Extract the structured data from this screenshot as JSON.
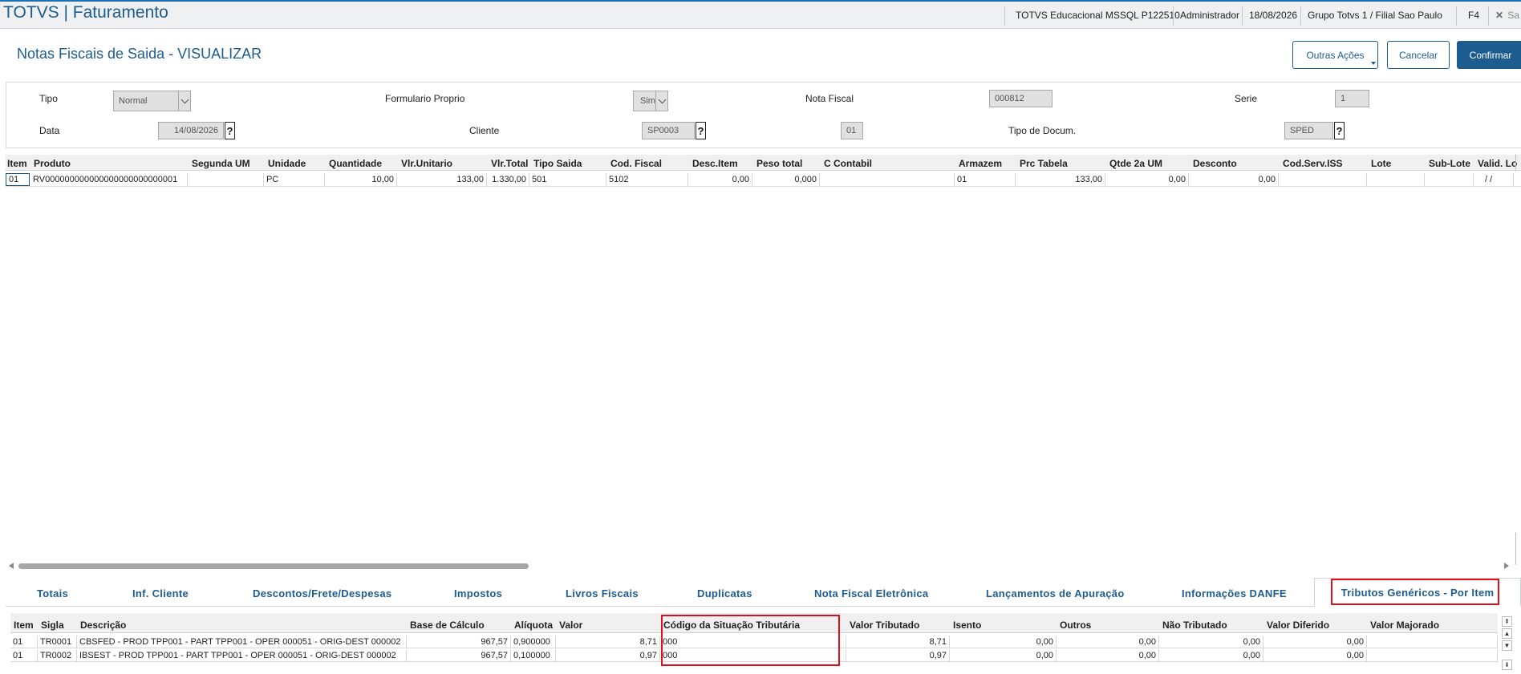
{
  "header": {
    "app_title": "TOTVS | Faturamento",
    "environment": "TOTVS Educacional MSSQL P122510",
    "user": "Administrador",
    "date": "18/08/2026",
    "branch": "Grupo Totvs 1 / Filial Sao Paulo",
    "shortcut": "F4",
    "exit_label": "Sa"
  },
  "page": {
    "title": "Notas Fiscais de Saida - VISUALIZAR",
    "actions": {
      "other_label": "Outras Ações",
      "cancel_label": "Cancelar",
      "confirm_label": "Confirmar"
    }
  },
  "form": {
    "tipo": {
      "label": "Tipo",
      "value": "Normal"
    },
    "formulario_proprio": {
      "label": "Formulario Proprio",
      "value": "Sim"
    },
    "nota_fiscal": {
      "label": "Nota Fiscal",
      "value": "000812"
    },
    "serie": {
      "label": "Serie",
      "value": "1"
    },
    "data": {
      "label": "Data",
      "value": "14/08/2026"
    },
    "cliente": {
      "label": "Cliente",
      "value": "SP0003",
      "loja": "01"
    },
    "tipo_documento": {
      "label": "Tipo de Docum.",
      "value": "SPED"
    },
    "lookup_symbol": "?"
  },
  "items_grid": {
    "columns": [
      "Item",
      "Produto",
      "Segunda UM",
      "Unidade",
      "Quantidade",
      "Vlr.Unitario",
      "Vlr.Total",
      "Tipo Saida",
      "Cod. Fiscal",
      "Desc.Item",
      "Peso total",
      "C Contabil",
      "Armazem",
      "Prc Tabela",
      "Qtde 2a UM",
      "Desconto",
      "Cod.Serv.ISS",
      "Lote",
      "Sub-Lote",
      "Valid. Lo"
    ],
    "rows": [
      [
        "01",
        "RV000000000000000000000000001",
        "",
        "PC",
        "10,00",
        "133,00",
        "1.330,00",
        "501",
        "5102",
        "0,00",
        "0,000",
        "",
        "01",
        "133,00",
        "0,00",
        "0,00",
        "",
        "",
        "",
        " /  / "
      ]
    ]
  },
  "tabs": [
    "Totais",
    "Inf. Cliente",
    "Descontos/Frete/Despesas",
    "Impostos",
    "Livros Fiscais",
    "Duplicatas",
    "Nota Fiscal Eletrônica",
    "Lançamentos de Apuração",
    "Informações DANFE",
    "Tributos Genéricos - Por Item"
  ],
  "active_tab": "Tributos Genéricos - Por Item",
  "tax_grid": {
    "columns": [
      "Item",
      "Sigla",
      "Descrição",
      "Base de Cálculo",
      "Alíquota",
      "Valor",
      "Código da Situação Tributária",
      "Valor Tributado",
      "Isento",
      "Outros",
      "Não Tributado",
      "Valor Diferido",
      "Valor Majorado"
    ],
    "rows": [
      [
        "01",
        "TR0001",
        "CBSFED - PROD TPP001 - PART TPP001 - OPER 000051 - ORIG-DEST 000002",
        "967,57",
        "0,900000",
        "8,71",
        "000",
        "8,71",
        "0,00",
        "0,00",
        "0,00",
        "0,00",
        ""
      ],
      [
        "01",
        "TR0002",
        "IBSEST - PROD TPP001 - PART TPP001 - OPER 000051 - ORIG-DEST 000002",
        "967,57",
        "0,100000",
        "0,97",
        "000",
        "0,97",
        "0,00",
        "0,00",
        "0,00",
        "0,00",
        ""
      ]
    ]
  },
  "colors": {
    "brand": "#1d5c8e",
    "highlight": "#e0101a"
  }
}
